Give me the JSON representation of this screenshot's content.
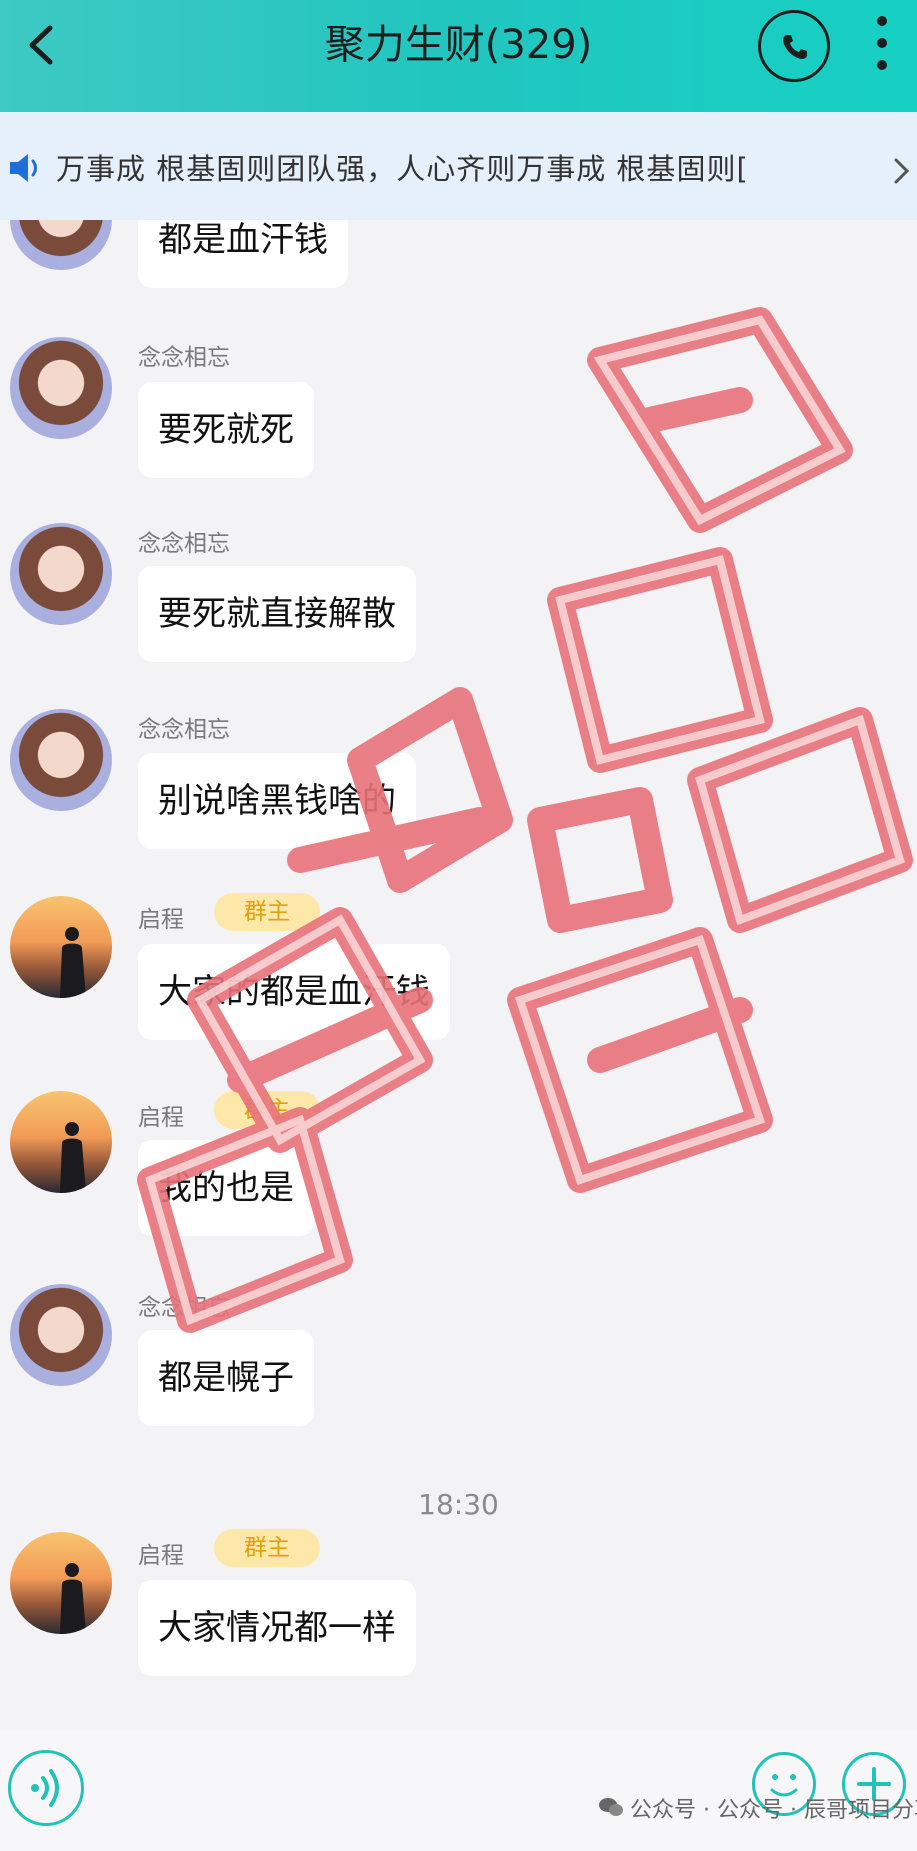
{
  "header": {
    "title": "聚力生财(329)",
    "accent": "#21c6bf"
  },
  "notice": {
    "text": "万事成    根基固则团队强，人心齐则万事成    根基固则["
  },
  "messages": [
    {
      "sender": "",
      "avatar": "girl",
      "text": "都是血汗钱"
    },
    {
      "sender": "念念相忘",
      "avatar": "girl",
      "text": "要死就死"
    },
    {
      "sender": "念念相忘",
      "avatar": "girl",
      "text": "要死就直接解散"
    },
    {
      "sender": "念念相忘",
      "avatar": "girl",
      "text": "别说啥黑钱啥的"
    },
    {
      "sender": "启程",
      "badge": "群主",
      "avatar": "sunset",
      "text": "大家的都是血汗钱"
    },
    {
      "sender": "启程",
      "badge": "群主",
      "avatar": "sunset",
      "text": "我的也是"
    },
    {
      "sender": "念念相忘",
      "avatar": "girl",
      "text": "都是幌子"
    },
    {
      "sender": "启程",
      "badge": "群主",
      "avatar": "sunset",
      "text": "大家情况都一样"
    }
  ],
  "timestamp": "18:30",
  "footer": {
    "watermark": "公众号 · 公众号 · 辰哥项目分享"
  },
  "stamp": {
    "text": "跑路大群 骗人黑钱",
    "color": "#e8727a"
  },
  "icons": {
    "back": "chevron-left-icon",
    "call": "phone-icon",
    "more": "more-vertical-icon",
    "speaker": "speaker-icon",
    "voice": "voice-icon",
    "emoji": "smile-icon",
    "add": "plus-icon"
  }
}
